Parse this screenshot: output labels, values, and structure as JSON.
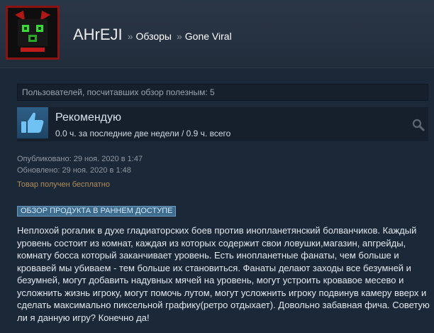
{
  "header": {
    "username": "AHrEJI",
    "separator": "»",
    "crumb_reviews": "Обзоры",
    "crumb_game": "Gone Viral"
  },
  "review": {
    "helpful_text": "Пользователей, посчитавших обзор полезным: 5",
    "recommendation": "Рекомендую",
    "hours": "0.0 ч. за последние две недели / 0.9 ч. всего",
    "posted": "Опубликовано: 29 ноя. 2020 в 1:47",
    "updated": "Обновлено: 29 ноя. 2020 в 1:48",
    "free_product": "Товар получен бесплатно",
    "early_access_badge": "ОБЗОР ПРОДУКТА В РАННЕМ ДОСТУПЕ",
    "text": "Неплохой рогалик в духе гладиаторских боев против инопланетянский болванчиков. Каждый уровень состоит из комнат, каждая из которых содержит свои ловушки,магазин, апгрейды, комнату босса который заканчивает уровень. Есть инопланетные фанаты, чем больше и кровавей мы убиваем - тем больше их становиться. Фанаты делают заходы все безумней и безумней, могут добавить надувных мячей на уровень, могут устроить кровавое месево и усложнить жизнь игроку, могут помочь лутом, могут усложнить игроку подвинув камеру вверх и сделать максимально пиксельной графику(ретро отдыхает). Довольно забавная фича. Советую ли я данную игру? Конечно да!"
  },
  "icons": {
    "avatar": "green-creature-avatar",
    "thumb": "thumbs-up-icon",
    "reviewer": "magnifier-icon"
  },
  "colors": {
    "background": "#1b2838",
    "free_product": "#b08d5a",
    "badge": "#3d6c8d"
  }
}
